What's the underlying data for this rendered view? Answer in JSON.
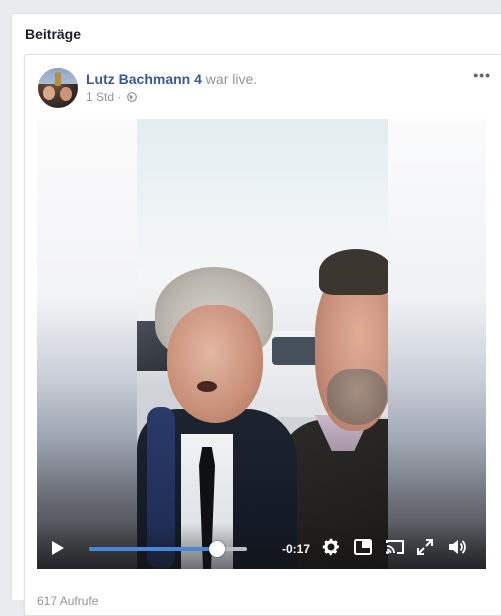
{
  "section": {
    "title": "Beiträge"
  },
  "post": {
    "author": "Lutz Bachmann 4",
    "action": "war live.",
    "time": "1 Std",
    "separator": "·",
    "more": "•••",
    "views": "617 Aufrufe"
  },
  "video": {
    "time_remaining": "-0:17",
    "progress": 0.81
  },
  "colors": {
    "progress": "#4a86d8",
    "link": "#385898"
  },
  "icons": [
    "globe-icon",
    "play-icon",
    "settings-gear-icon",
    "picture-in-picture-icon",
    "cast-icon",
    "fullscreen-icon",
    "volume-icon",
    "more-options-icon"
  ]
}
